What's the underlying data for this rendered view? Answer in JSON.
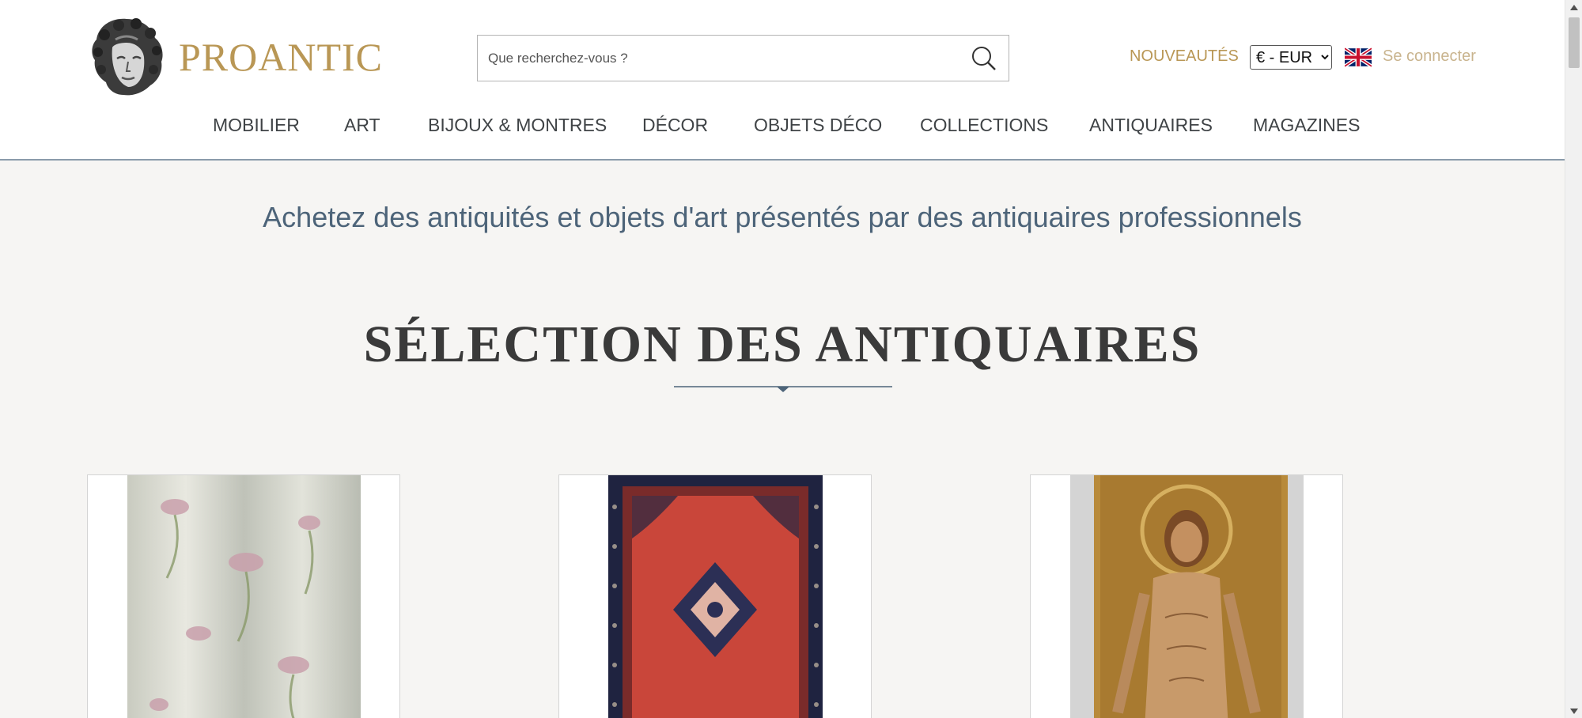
{
  "header": {
    "brand": "PROANTIC",
    "search_placeholder": "Que recherchez-vous ?",
    "new_label": "NOUVEAUTÉS",
    "currency_options": [
      "€ - EUR"
    ],
    "currency_selected": "€ - EUR",
    "language_icon": "uk-flag-icon",
    "login_label": "Se connecter"
  },
  "nav": {
    "items": [
      {
        "label": "MOBILIER"
      },
      {
        "label": "ART"
      },
      {
        "label": "BIJOUX & MONTRES"
      },
      {
        "label": "DÉCOR"
      },
      {
        "label": "OBJETS DÉCO"
      },
      {
        "label": "COLLECTIONS"
      },
      {
        "label": "ANTIQUAIRES"
      },
      {
        "label": "MAGAZINES"
      }
    ]
  },
  "main": {
    "tagline": "Achetez des antiquités et objets d'art présentés par des antiquaires professionnels",
    "section_title": "SÉLECTION DES ANTIQUAIRES"
  },
  "products": [
    {
      "image": "silk-fabric-image"
    },
    {
      "image": "persian-rug-image"
    },
    {
      "image": "christ-icon-painting-image"
    }
  ],
  "colors": {
    "brand_gold": "#b99755",
    "nav_text": "#3f4346",
    "tagline_blue": "#4d6479",
    "page_background": "#f6f5f3"
  }
}
